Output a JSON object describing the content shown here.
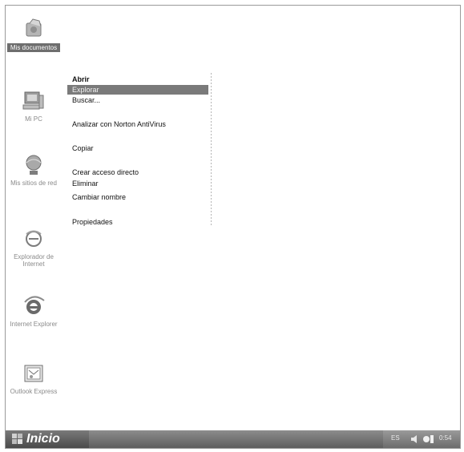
{
  "desktop": {
    "icons": [
      {
        "name": "my-documents-icon",
        "label": "Mis documentos"
      },
      {
        "name": "my-computer-icon",
        "label": "Mi PC"
      },
      {
        "name": "network-places-icon",
        "label": "Mis sitios de red"
      },
      {
        "name": "internet-explorer-icon",
        "label": "Explorador de Internet"
      },
      {
        "name": "ie-browser-icon",
        "label": "Internet Explorer"
      },
      {
        "name": "outlook-express-icon",
        "label": "Outlook Express"
      }
    ]
  },
  "context_menu": {
    "items": [
      {
        "label": "Abrir",
        "bold": true
      },
      {
        "label": "Explorar",
        "highlighted": true
      },
      {
        "label": "Buscar..."
      },
      {
        "label": "Analizar con Norton AntiVirus"
      },
      {
        "label": "Copiar"
      },
      {
        "label": "Crear acceso directo"
      },
      {
        "label": "Eliminar"
      },
      {
        "label": "Cambiar nombre"
      },
      {
        "label": "Propiedades"
      }
    ]
  },
  "taskbar": {
    "start_label": "Inicio",
    "language": "ES",
    "clock": "0:54"
  }
}
